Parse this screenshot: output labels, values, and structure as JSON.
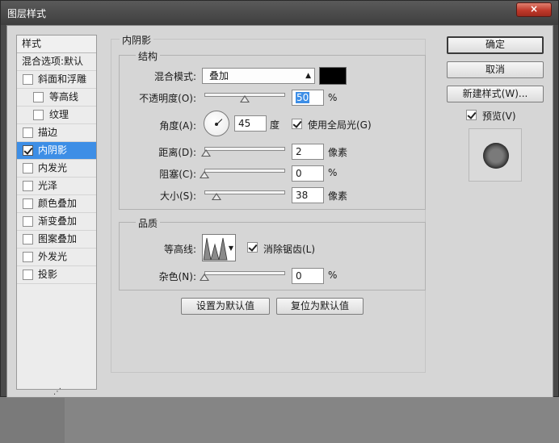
{
  "window": {
    "title": "图层样式",
    "close_label": "×"
  },
  "sidebar": {
    "header": "样式",
    "items": [
      {
        "label": "混合选项:默认",
        "has_checkbox": false,
        "checked": false,
        "indent": false,
        "active": false
      },
      {
        "label": "斜面和浮雕",
        "has_checkbox": true,
        "checked": false,
        "indent": false,
        "active": false
      },
      {
        "label": "等高线",
        "has_checkbox": true,
        "checked": false,
        "indent": true,
        "active": false
      },
      {
        "label": "纹理",
        "has_checkbox": true,
        "checked": false,
        "indent": true,
        "active": false
      },
      {
        "label": "描边",
        "has_checkbox": true,
        "checked": false,
        "indent": false,
        "active": false
      },
      {
        "label": "内阴影",
        "has_checkbox": true,
        "checked": true,
        "indent": false,
        "active": true
      },
      {
        "label": "内发光",
        "has_checkbox": true,
        "checked": false,
        "indent": false,
        "active": false
      },
      {
        "label": "光泽",
        "has_checkbox": true,
        "checked": false,
        "indent": false,
        "active": false
      },
      {
        "label": "颜色叠加",
        "has_checkbox": true,
        "checked": false,
        "indent": false,
        "active": false
      },
      {
        "label": "渐变叠加",
        "has_checkbox": true,
        "checked": false,
        "indent": false,
        "active": false
      },
      {
        "label": "图案叠加",
        "has_checkbox": true,
        "checked": false,
        "indent": false,
        "active": false
      },
      {
        "label": "外发光",
        "has_checkbox": true,
        "checked": false,
        "indent": false,
        "active": false
      },
      {
        "label": "投影",
        "has_checkbox": true,
        "checked": false,
        "indent": false,
        "active": false
      }
    ]
  },
  "panel": {
    "title": "内阴影",
    "structure": {
      "label": "结构",
      "blend_mode_label": "混合模式:",
      "blend_mode_value": "叠加",
      "shadow_color": "#000000",
      "opacity_label": "不透明度(O):",
      "opacity_value": "50",
      "opacity_unit": "%",
      "opacity_fraction": 0.5,
      "angle_label": "角度(A):",
      "angle_value": "45",
      "angle_unit": "度",
      "global_light_label": "使用全局光(G)",
      "global_light_checked": true,
      "distance_label": "距离(D):",
      "distance_value": "2",
      "distance_unit": "像素",
      "distance_fraction": 0.02,
      "choke_label": "阻塞(C):",
      "choke_value": "0",
      "choke_unit": "%",
      "choke_fraction": 0.0,
      "size_label": "大小(S):",
      "size_value": "38",
      "size_unit": "像素",
      "size_fraction": 0.15
    },
    "quality": {
      "label": "品质",
      "contour_label": "等高线:",
      "anti_alias_label": "消除锯齿(L)",
      "anti_alias_checked": true,
      "noise_label": "杂色(N):",
      "noise_value": "0",
      "noise_unit": "%",
      "noise_fraction": 0.0
    },
    "make_default_label": "设置为默认值",
    "reset_default_label": "复位为默认值"
  },
  "actions": {
    "ok_label": "确定",
    "cancel_label": "取消",
    "new_style_label": "新建样式(W)...",
    "preview_label": "预览(V)",
    "preview_checked": true
  },
  "colors": {
    "accent": "#3d8ee6",
    "dialog_bg": "#d6d6d6",
    "frame": "#4a4a4a"
  }
}
